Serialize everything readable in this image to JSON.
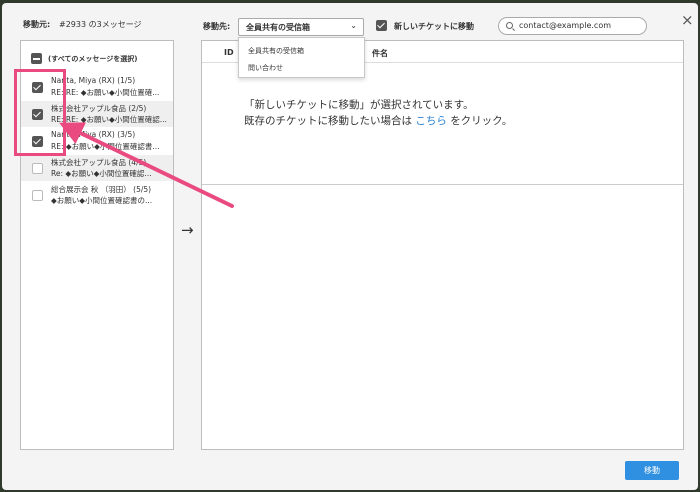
{
  "header": {
    "source_label": "移動元:",
    "source_value": "#2933 の3メッセージ",
    "dest_label": "移動先:",
    "dest_selected": "全員共有の受信箱",
    "dest_options": [
      "全員共有の受信箱",
      "問い合わせ"
    ],
    "new_ticket_label": "新しいチケットに移動",
    "new_ticket_checked": true,
    "search_value": "contact@example.com"
  },
  "left": {
    "select_all_label": "(すべてのメッセージを選択)",
    "items": [
      {
        "line1": "Narita, Miya (RX)  (1/5)",
        "line2": "RE: RE: ◆お願い◆小間位置確...",
        "checked": true
      },
      {
        "line1": "株式会社アップル食品  (2/5)",
        "line2": "RE: RE: ◆お願い◆小間位置確認...",
        "checked": true
      },
      {
        "line1": "Narita, Miya (RX)  (3/5)",
        "line2": "RE: ◆お願い◆小間位置確認書...",
        "checked": true
      },
      {
        "line1": "株式会社アップル食品  (4/5)",
        "line2": "Re: ◆お願い◆小間位置確認...",
        "checked": false
      },
      {
        "line1": "総合展示会 秋 （羽田）  (5/5)",
        "line2": "◆お願い◆小間位置確認書の...",
        "checked": false
      }
    ]
  },
  "right": {
    "col_id": "ID",
    "col_subject": "件名",
    "message_line1": "「新しいチケットに移動」が選択されています。",
    "message_line2_pre": "既存のチケットに移動したい場合は",
    "message_link": "こちら",
    "message_line2_post": "をクリック。"
  },
  "move_button": "移動",
  "close_symbol": "×",
  "arrow_symbol": "→",
  "colors": {
    "accent": "#2f8fe0",
    "highlight": "#e94a7f",
    "link": "#2a7fd0"
  }
}
